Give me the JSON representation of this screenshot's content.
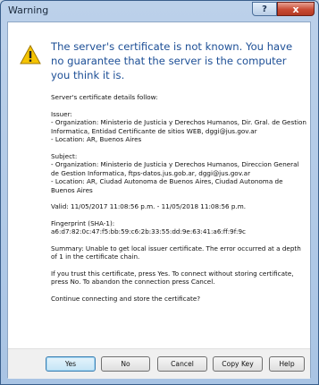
{
  "window": {
    "title": "Warning",
    "help_label": "?",
    "close_label": "x"
  },
  "headline": "The server's certificate is not known. You have no guarantee that the server is the computer you think it is.",
  "details": {
    "intro": "Server's certificate details follow:",
    "issuer_heading": "Issuer:",
    "issuer_org": "- Organization: Ministerio de Justicia y Derechos Humanos, Dir. Gral. de Gestion Informatica, Entidad Certificante de sitios WEB, dggi@jus.gov.ar",
    "issuer_location": "- Location: AR, Buenos Aires",
    "subject_heading": "Subject:",
    "subject_org": "- Organization: Ministerio de Justicia y Derechos Humanos, Direccion General de Gestion Informatica, ftps-datos.jus.gob.ar, dggi@jus.gov.ar",
    "subject_location": "- Location: AR, Ciudad Autonoma de Buenos Aires, Ciudad Autonoma de Buenos Aires",
    "valid": "Valid: 11/05/2017 11:08:56 p.m. - 11/05/2018 11:08:56 p.m.",
    "fingerprint_heading": "Fingerprint (SHA-1):",
    "fingerprint_value": "a6:d7:82:0c:47:f5:bb:59:c6:2b:33:55:dd:9e:63:41:a6:ff:9f:9c",
    "summary": "Summary: Unable to get local issuer certificate. The error occurred at a depth of 1 in the certificate chain.",
    "instructions": "If you trust this certificate, press Yes. To connect without storing certificate, press No. To abandon the connection press Cancel.",
    "question": "Continue connecting and store the certificate?"
  },
  "buttons": {
    "yes": "Yes",
    "no": "No",
    "cancel": "Cancel",
    "copy_key": "Copy Key",
    "help": "Help"
  },
  "icon": "warning-icon",
  "colors": {
    "headline": "#1d4f96",
    "warning_fill": "#f5c400",
    "close_button": "#c94a33"
  }
}
